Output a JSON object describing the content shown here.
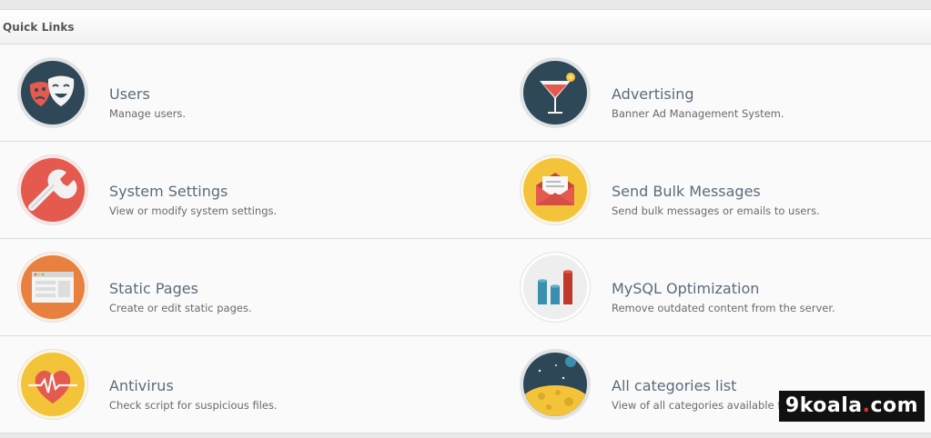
{
  "header": {
    "title": "Quick Links"
  },
  "links": [
    {
      "title": "Users",
      "desc": "Manage users.",
      "icon": "theater-masks-icon"
    },
    {
      "title": "Advertising",
      "desc": "Banner Ad Management System.",
      "icon": "cocktail-icon"
    },
    {
      "title": "System Settings",
      "desc": "View or modify system settings.",
      "icon": "wrench-icon"
    },
    {
      "title": "Send Bulk Messages",
      "desc": "Send bulk messages or emails to users.",
      "icon": "envelope-icon"
    },
    {
      "title": "Static Pages",
      "desc": "Create or edit static pages.",
      "icon": "browser-window-icon"
    },
    {
      "title": "MySQL Optimization",
      "desc": "Remove outdated content from the server.",
      "icon": "bar-chart-icon"
    },
    {
      "title": "Antivirus",
      "desc": "Check script for suspicious files.",
      "icon": "heart-pulse-icon"
    },
    {
      "title": "All categories list",
      "desc": "View of all categories available fo",
      "icon": "moon-planet-icon"
    }
  ],
  "watermark": {
    "prefix": "9koala",
    "dot": ".",
    "suffix": "com"
  },
  "colors": {
    "users_bg": "#2f4858",
    "advertising_bg": "#2f4858",
    "settings_bg": "#e45a4f",
    "messages_bg": "#f3c43a",
    "pages_bg": "#e8803f",
    "mysql_bg": "#eeeeee",
    "antivirus_bg": "#f3c43a",
    "categories_bg": "#2e4756",
    "title_text": "#5a6c7c"
  }
}
